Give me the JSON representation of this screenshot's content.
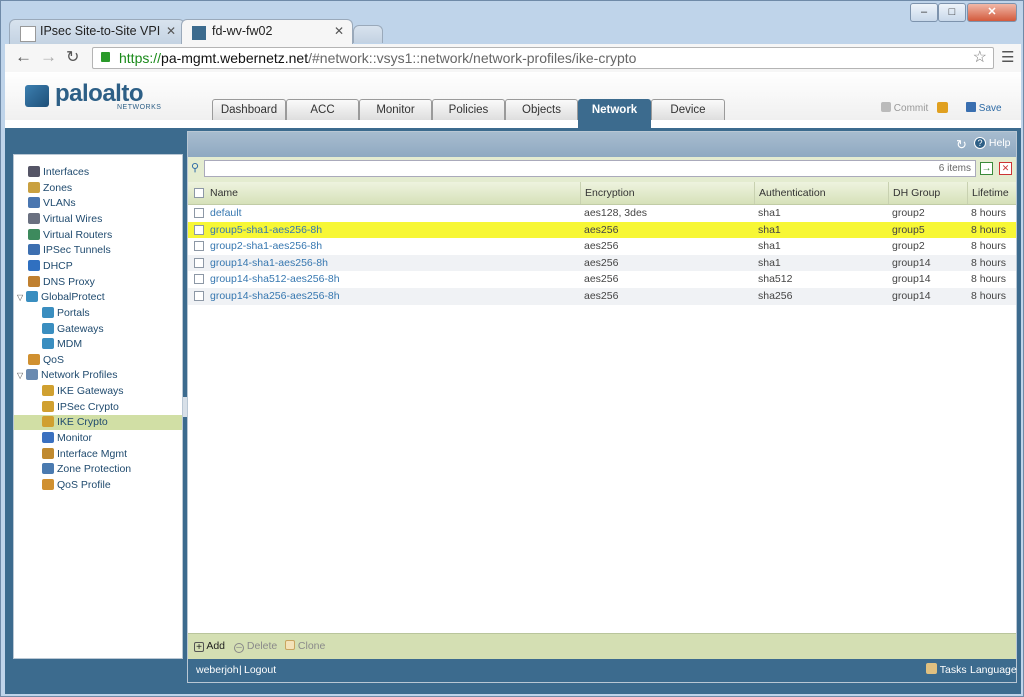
{
  "browser": {
    "tabs": [
      {
        "title": "IPsec Site-to-Site VPI",
        "active": false
      },
      {
        "title": "fd-wv-fw02",
        "active": true
      }
    ],
    "url": {
      "scheme": "https://",
      "host": "pa-mgmt.webernetz.net",
      "path": "/#network::vsys1::network/network-profiles/ike-crypto"
    }
  },
  "app": {
    "logo_main": "paloalto",
    "logo_sub": "NETWORKS",
    "tabs": [
      "Dashboard",
      "ACC",
      "Monitor",
      "Policies",
      "Objects",
      "Network",
      "Device"
    ],
    "active_tab": "Network",
    "commit_label": "Commit",
    "save_label": "Save",
    "help_label": "Help",
    "accent": "#3c6b8e",
    "highlight": "#f7f735"
  },
  "sidebar": {
    "items": [
      {
        "label": "Interfaces",
        "icon": "interfaces-icon"
      },
      {
        "label": "Zones",
        "icon": "zones-icon"
      },
      {
        "label": "VLANs",
        "icon": "vlans-icon"
      },
      {
        "label": "Virtual Wires",
        "icon": "virtual-wires-icon"
      },
      {
        "label": "Virtual Routers",
        "icon": "virtual-routers-icon"
      },
      {
        "label": "IPSec Tunnels",
        "icon": "ipsec-tunnels-icon"
      },
      {
        "label": "DHCP",
        "icon": "dhcp-icon"
      },
      {
        "label": "DNS Proxy",
        "icon": "dns-proxy-icon"
      },
      {
        "label": "GlobalProtect",
        "icon": "globalprotect-icon"
      },
      {
        "label": "Portals",
        "icon": "portals-icon"
      },
      {
        "label": "Gateways",
        "icon": "gateways-icon"
      },
      {
        "label": "MDM",
        "icon": "mdm-icon"
      },
      {
        "label": "QoS",
        "icon": "qos-icon"
      },
      {
        "label": "Network Profiles",
        "icon": "network-profiles-icon"
      },
      {
        "label": "IKE Gateways",
        "icon": "ike-gateways-icon"
      },
      {
        "label": "IPSec Crypto",
        "icon": "ipsec-crypto-icon"
      },
      {
        "label": "IKE Crypto",
        "icon": "ike-crypto-icon"
      },
      {
        "label": "Monitor",
        "icon": "monitor-icon"
      },
      {
        "label": "Interface Mgmt",
        "icon": "interface-mgmt-icon"
      },
      {
        "label": "Zone Protection",
        "icon": "zone-protection-icon"
      },
      {
        "label": "QoS Profile",
        "icon": "qos-profile-icon"
      }
    ]
  },
  "main": {
    "filter_placeholder": "",
    "item_count": "6 items",
    "columns": [
      "Name",
      "Encryption",
      "Authentication",
      "DH Group",
      "Lifetime"
    ],
    "rows": [
      {
        "name": "default",
        "encryption": "aes128, 3des",
        "authentication": "sha1",
        "dh_group": "group2",
        "lifetime": "8 hours"
      },
      {
        "name": "group5-sha1-aes256-8h",
        "encryption": "aes256",
        "authentication": "sha1",
        "dh_group": "group5",
        "lifetime": "8 hours"
      },
      {
        "name": "group2-sha1-aes256-8h",
        "encryption": "aes256",
        "authentication": "sha1",
        "dh_group": "group2",
        "lifetime": "8 hours"
      },
      {
        "name": "group14-sha1-aes256-8h",
        "encryption": "aes256",
        "authentication": "sha1",
        "dh_group": "group14",
        "lifetime": "8 hours"
      },
      {
        "name": "group14-sha512-aes256-8h",
        "encryption": "aes256",
        "authentication": "sha512",
        "dh_group": "group14",
        "lifetime": "8 hours"
      },
      {
        "name": "group14-sha256-aes256-8h",
        "encryption": "aes256",
        "authentication": "sha256",
        "dh_group": "group14",
        "lifetime": "8 hours"
      }
    ],
    "actions": {
      "add": "Add",
      "delete": "Delete",
      "clone": "Clone"
    }
  },
  "status": {
    "user": "weberjoh",
    "logout": "Logout",
    "tasks": "Tasks",
    "language": "Language"
  }
}
